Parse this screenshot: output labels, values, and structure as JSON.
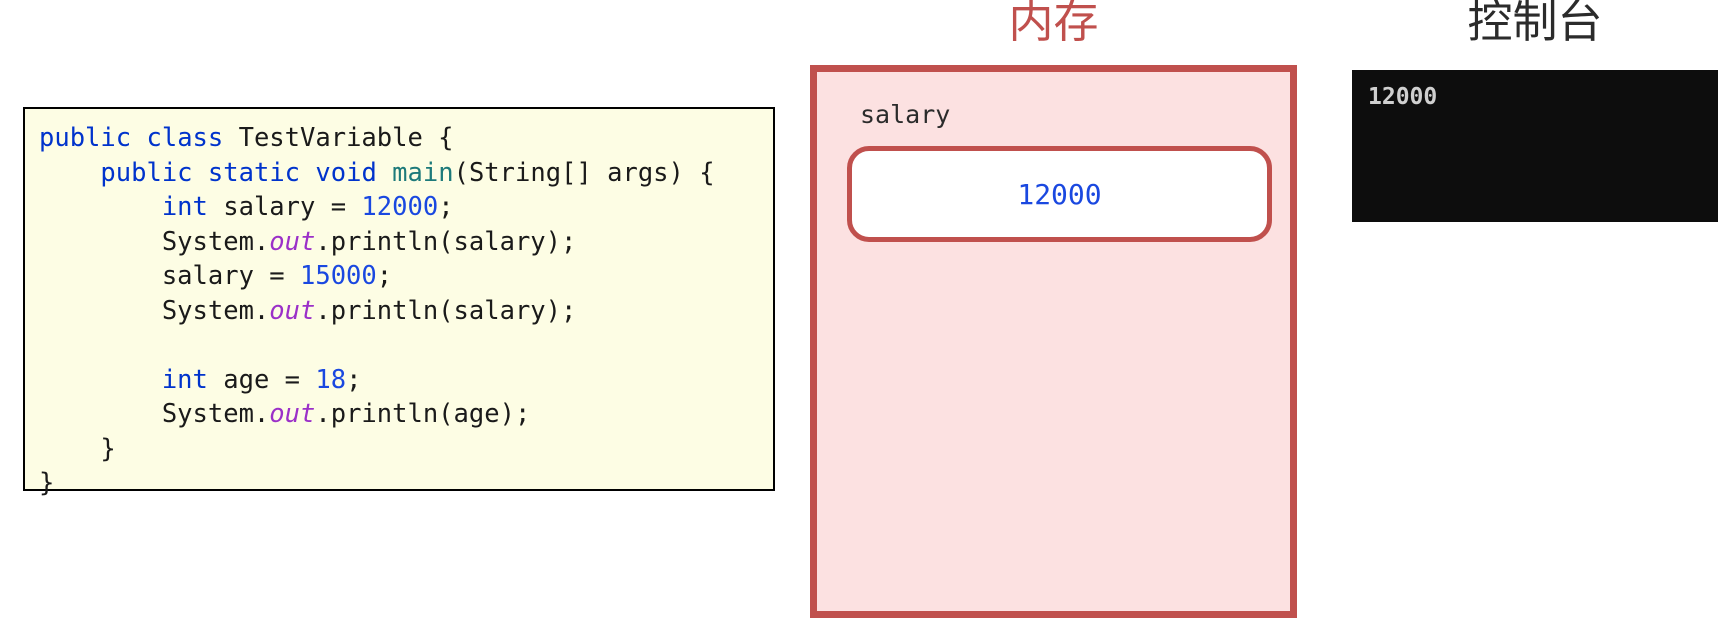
{
  "code_panel": {
    "language": "java",
    "lines": [
      [
        {
          "t": "public",
          "c": "kw"
        },
        {
          "t": " ",
          "c": "pl"
        },
        {
          "t": "class",
          "c": "kw"
        },
        {
          "t": " TestVariable {",
          "c": "pl"
        }
      ],
      [
        {
          "t": "    ",
          "c": "pl"
        },
        {
          "t": "public",
          "c": "kw"
        },
        {
          "t": " ",
          "c": "pl"
        },
        {
          "t": "static",
          "c": "kw"
        },
        {
          "t": " ",
          "c": "pl"
        },
        {
          "t": "void",
          "c": "kw"
        },
        {
          "t": " ",
          "c": "pl"
        },
        {
          "t": "main",
          "c": "meth"
        },
        {
          "t": "(String[] args) {",
          "c": "pl"
        }
      ],
      [
        {
          "t": "        ",
          "c": "pl"
        },
        {
          "t": "int",
          "c": "kw"
        },
        {
          "t": " salary = ",
          "c": "pl"
        },
        {
          "t": "12000",
          "c": "num"
        },
        {
          "t": ";",
          "c": "pl"
        }
      ],
      [
        {
          "t": "        System.",
          "c": "pl"
        },
        {
          "t": "out",
          "c": "fld"
        },
        {
          "t": ".println(salary);",
          "c": "pl"
        }
      ],
      [
        {
          "t": "        salary = ",
          "c": "pl"
        },
        {
          "t": "15000",
          "c": "num"
        },
        {
          "t": ";",
          "c": "pl"
        }
      ],
      [
        {
          "t": "        System.",
          "c": "pl"
        },
        {
          "t": "out",
          "c": "fld"
        },
        {
          "t": ".println(salary);",
          "c": "pl"
        }
      ],
      [
        {
          "t": "",
          "c": "pl"
        }
      ],
      [
        {
          "t": "        ",
          "c": "pl"
        },
        {
          "t": "int",
          "c": "kw"
        },
        {
          "t": " age = ",
          "c": "pl"
        },
        {
          "t": "18",
          "c": "num"
        },
        {
          "t": ";",
          "c": "pl"
        }
      ],
      [
        {
          "t": "        System.",
          "c": "pl"
        },
        {
          "t": "out",
          "c": "fld"
        },
        {
          "t": ".println(age);",
          "c": "pl"
        }
      ],
      [
        {
          "t": "    }",
          "c": "pl"
        }
      ],
      [
        {
          "t": "}",
          "c": "pl"
        }
      ]
    ]
  },
  "memory": {
    "title": "内存",
    "variable_label": "salary",
    "variable_value": "12000",
    "border_color": "#c0504d",
    "fill_color": "#fce1e1",
    "title_color": "#c0504d",
    "value_color": "#1a48e0"
  },
  "console": {
    "title": "控制台",
    "title_color": "#2b2b2b",
    "background_color": "#0d0d0d",
    "text_color": "#cfcfcf",
    "lines": [
      "12000"
    ]
  }
}
